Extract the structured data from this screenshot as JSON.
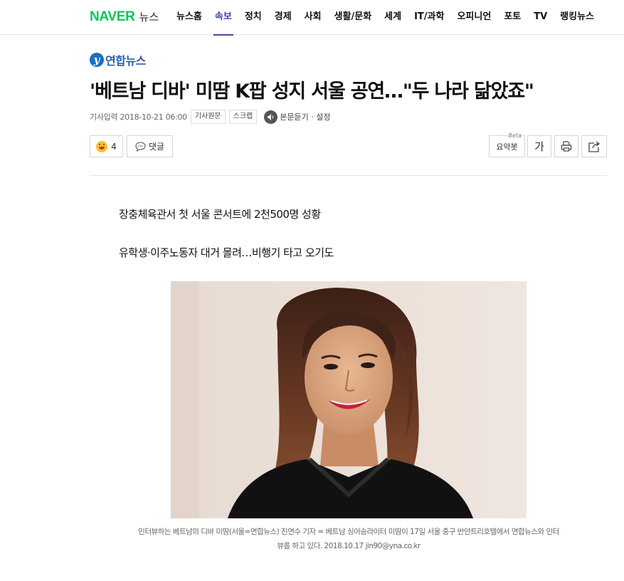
{
  "gnb": {
    "logo": "NAVER",
    "service": "뉴스",
    "items": [
      {
        "label": "뉴스홈",
        "active": false
      },
      {
        "label": "속보",
        "active": true
      },
      {
        "label": "정치",
        "active": false
      },
      {
        "label": "경제",
        "active": false
      },
      {
        "label": "사회",
        "active": false
      },
      {
        "label": "생활/문화",
        "active": false
      },
      {
        "label": "세계",
        "active": false
      },
      {
        "label": "IT/과학",
        "active": false
      },
      {
        "label": "오피니언",
        "active": false
      },
      {
        "label": "포토",
        "active": false
      },
      {
        "label": "TV",
        "active": false
      },
      {
        "label": "랭킹뉴스",
        "active": false
      }
    ],
    "active_color": "#3a4ca8",
    "brand_color": "#03c75a"
  },
  "article": {
    "press": "연합뉴스",
    "title": "'베트남 디바' 미땀 K팝 성지 서울 공연…\"두 나라 닮았죠\"",
    "date": "기사입력 2018-10-21 06:00",
    "original_label": "기사원문",
    "scrap_label": "스크랩",
    "tts_label": "본문듣기 · 설정",
    "like_count": "4",
    "comment_label": "댓글",
    "summary_label": "요약봇",
    "summary_badge": "Beta",
    "font_label": "가",
    "subtitles": [
      "장충체육관서 첫 서울 콘서트에 2천500명 성황",
      "유학생·이주노동자 대거 몰려…비행기 타고 오기도"
    ],
    "caption_line1": "인터뷰하는 베트남의 디바 미땀(서울=연합뉴스) 진연수 기자 = 베트남 싱어송라이터 미땀이 17일 서울 중구 반얀트리호텔에서 연합뉴스와 인터",
    "caption_line2": "뷰를 하고 있다. 2018.10.17 jin90@yna.co.kr"
  }
}
